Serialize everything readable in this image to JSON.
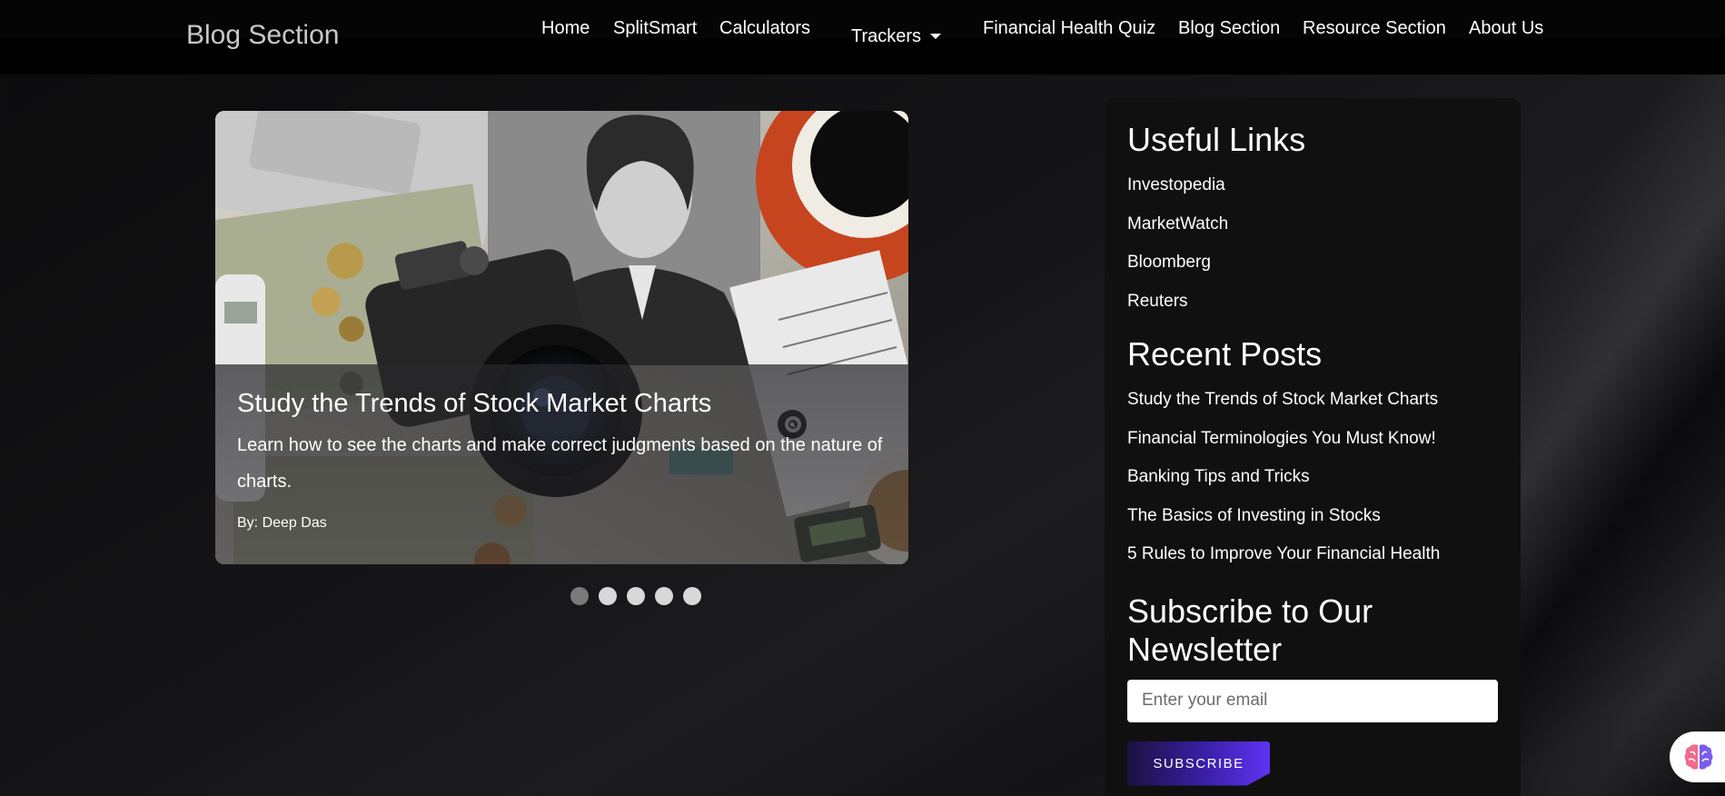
{
  "navbar": {
    "brand": "Blog Section",
    "links": [
      "Home",
      "SplitSmart",
      "Calculators",
      "Trackers",
      "Financial Health Quiz",
      "Blog Section",
      "Resource Section",
      "About Us"
    ]
  },
  "carousel": {
    "slide": {
      "title": "Study the Trends of Stock Market Charts",
      "description": "Learn how to see the charts and make correct judgments based on the nature of charts.",
      "author": "By: Deep Das"
    },
    "slide_count": 5,
    "active_index": 0
  },
  "sidebar": {
    "useful_links_title": "Useful Links",
    "useful_links": [
      "Investopedia",
      "MarketWatch",
      "Bloomberg",
      "Reuters"
    ],
    "recent_posts_title": "Recent Posts",
    "recent_posts": [
      "Study the Trends of Stock Market Charts",
      "Financial Terminologies You Must Know!",
      "Banking Tips and Tricks",
      "The Basics of Investing in Stocks",
      "5 Rules to Improve Your Financial Health"
    ],
    "newsletter_title": "Subscribe to Our Newsletter",
    "email_placeholder": "Enter your email",
    "subscribe_label": "SUBSCRIBE"
  },
  "widget": {
    "icon": "brain-icon"
  },
  "colors": {
    "accent": "#5f33f2",
    "accent_dark": "#1a1240",
    "panel": "#101010"
  }
}
